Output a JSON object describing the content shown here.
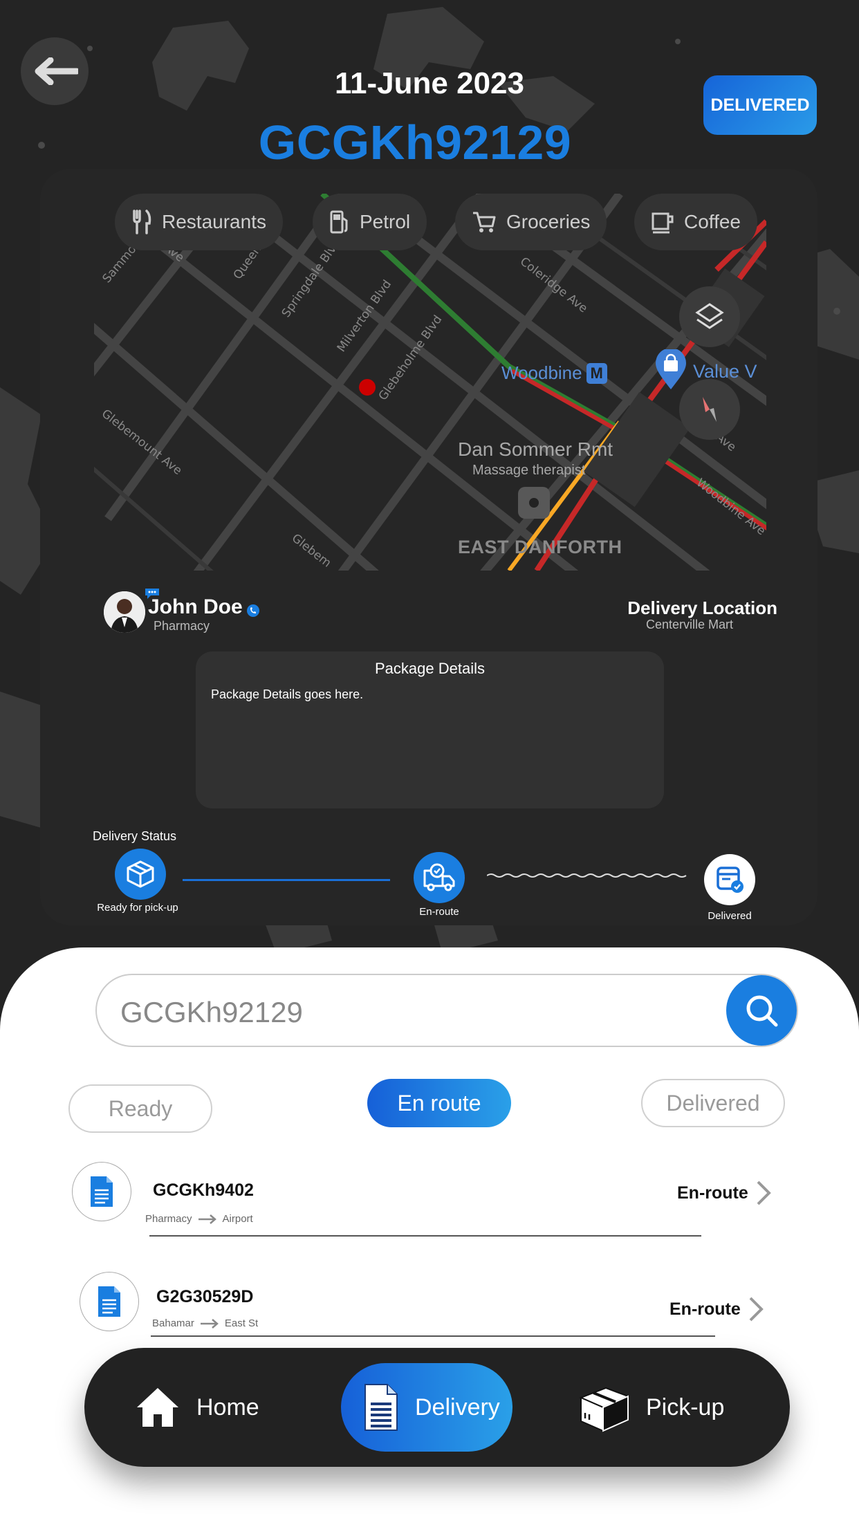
{
  "header": {
    "date": "11-June 2023",
    "tracking_code": "GCGKh92129",
    "status": "DELIVERED"
  },
  "map": {
    "chips": [
      {
        "label": "Restaurants",
        "icon": "fork-knife-icon"
      },
      {
        "label": "Petrol",
        "icon": "fuel-pump-icon"
      },
      {
        "label": "Groceries",
        "icon": "cart-icon"
      },
      {
        "label": "Coffee",
        "icon": "coffee-cup-icon"
      }
    ],
    "streets": [
      "Sammon Ave",
      "Queen",
      "Springdale Blvd",
      "Milverton Blvd",
      "Glebeholme Blvd",
      "Glebemount Ave",
      "Glebem",
      "Coleridge Ave",
      "Woodbine Ave",
      "Ave",
      "th Ave"
    ],
    "places": {
      "station": "Woodbine",
      "store": "Value V",
      "business_name": "Dan Sommer Rmt",
      "business_type": "Massage therapist",
      "area": "EAST DANFORTH"
    }
  },
  "sender": {
    "name": "John Doe",
    "role": "Pharmacy"
  },
  "destination": {
    "title": "Delivery Location",
    "place": "Centerville Mart"
  },
  "package": {
    "title": "Package Details",
    "body": "Package Details goes here."
  },
  "delivery_status": {
    "label": "Delivery Status",
    "steps": [
      {
        "label": "Ready for pick-up",
        "icon": "box-icon"
      },
      {
        "label": "En-route",
        "icon": "truck-icon"
      },
      {
        "label": "Delivered",
        "icon": "delivered-doc-icon"
      }
    ]
  },
  "search": {
    "value": "GCGKh92129"
  },
  "filters": {
    "ready": "Ready",
    "en_route": "En route",
    "delivered": "Delivered",
    "selected": "En route"
  },
  "orders": [
    {
      "code": "GCGKh9402",
      "from": "Pharmacy",
      "to": "Airport",
      "status": "En-route"
    },
    {
      "code": "G2G30529D",
      "from": "Bahamar",
      "to": "East St",
      "status": "En-route"
    }
  ],
  "nav": {
    "home": "Home",
    "delivery": "Delivery",
    "pickup": "Pick-up",
    "active": "Delivery"
  },
  "colors": {
    "accent": "#1a7ee0",
    "background": "#242424",
    "card": "#262626"
  }
}
